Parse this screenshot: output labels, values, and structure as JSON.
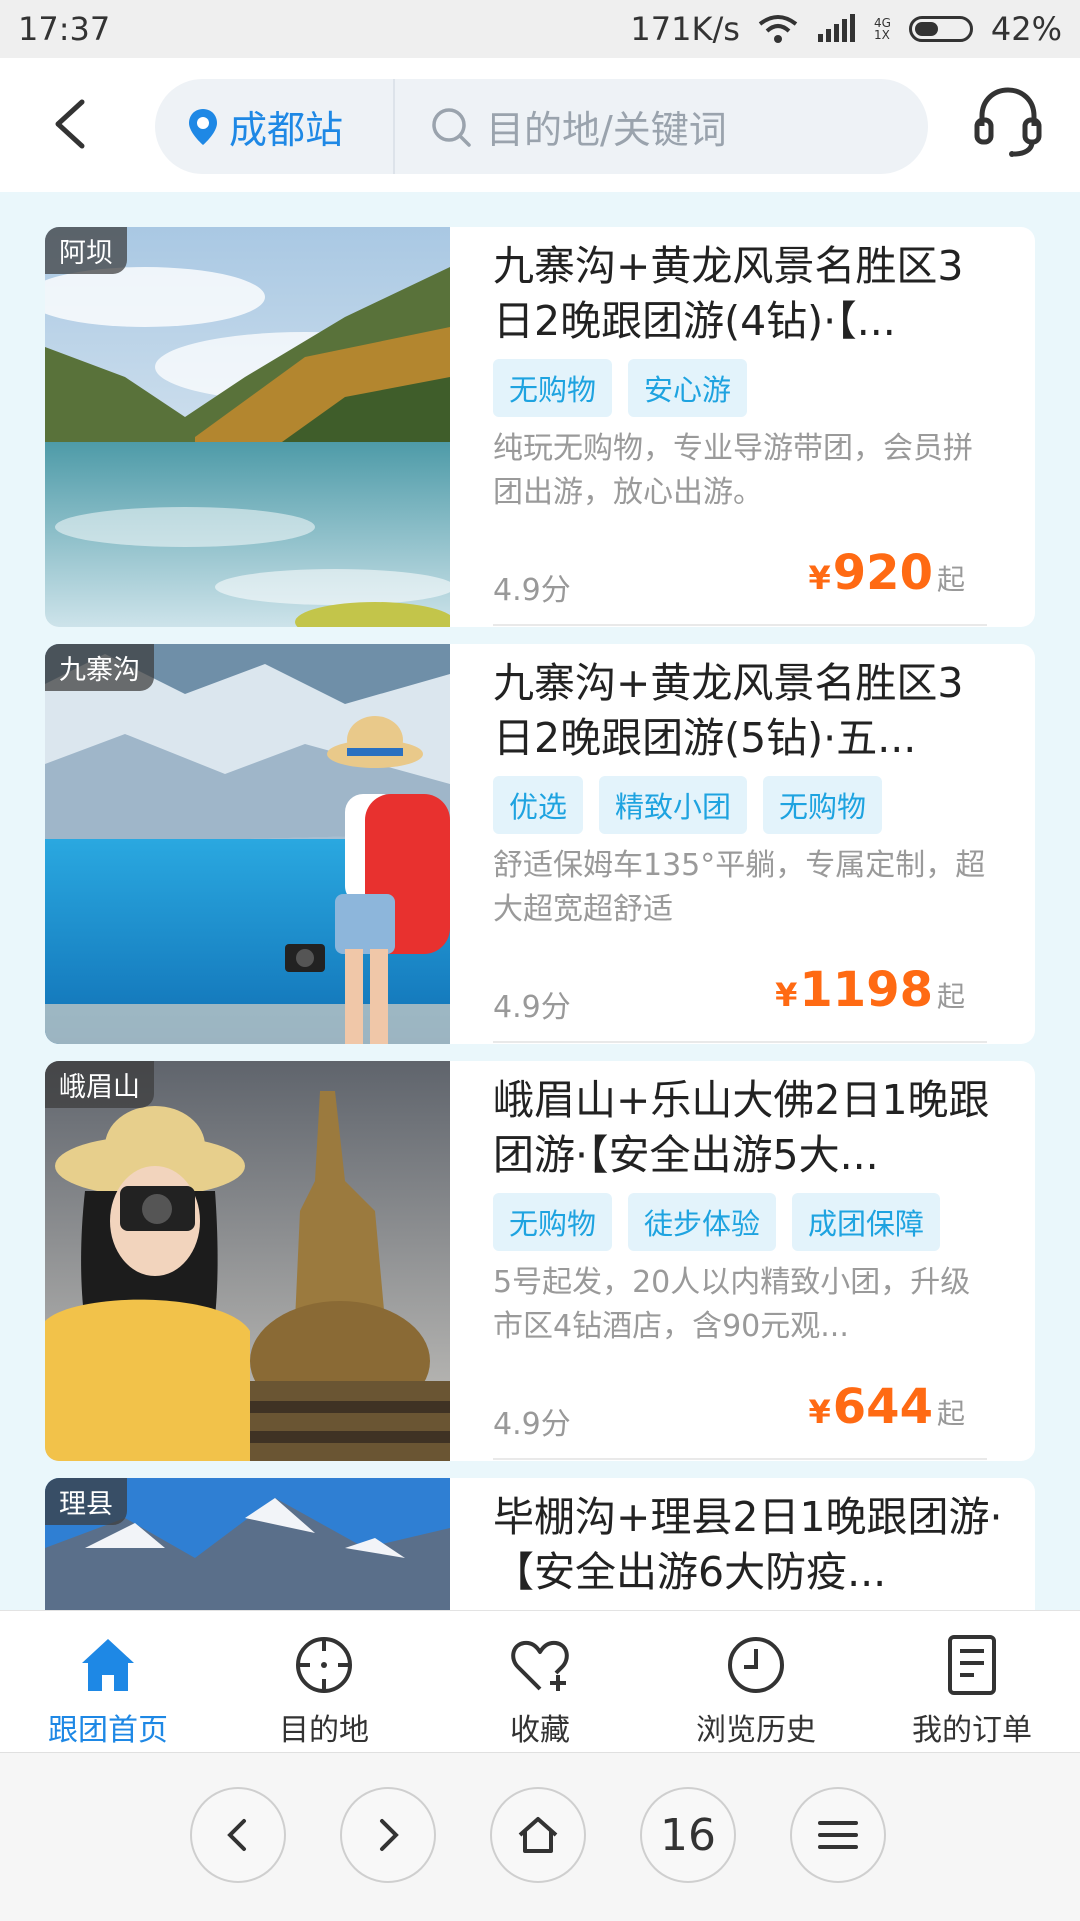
{
  "status_bar": {
    "time": "17:37",
    "speed": "171K/s",
    "network_top": "4G",
    "network_bottom": "1X",
    "battery": "42%"
  },
  "header": {
    "back_icon": "chevron-left-icon",
    "city": "成都站",
    "search_placeholder": "目的地/关键词",
    "service_icon": "headset-icon",
    "accent": "#1e88e5"
  },
  "products": [
    {
      "location": "阿坝",
      "title": "九寨沟+黄龙风景名胜区3日2晚跟团游(4钻)·【...",
      "tags": [
        "无购物",
        "安心游"
      ],
      "desc": "纯玩无购物，专业导游带团，会员拼团出游，放心出游。",
      "score": "4.9分",
      "currency": "¥",
      "price": "920",
      "price_suffix": "起"
    },
    {
      "location": "九寨沟",
      "title": "九寨沟+黄龙风景名胜区3日2晚跟团游(5钻)·五...",
      "tags": [
        "优选",
        "精致小团",
        "无购物"
      ],
      "desc": "舒适保姆车135°平躺，专属定制，超大超宽超舒适",
      "score": "4.9分",
      "currency": "¥",
      "price": "1198",
      "price_suffix": "起"
    },
    {
      "location": "峨眉山",
      "title": "峨眉山+乐山大佛2日1晚跟团游·【安全出游5大...",
      "tags": [
        "无购物",
        "徒步体验",
        "成团保障"
      ],
      "desc": "5号起发，20人以内精致小团，升级市区4钻酒店，含90元观...",
      "score": "4.9分",
      "currency": "¥",
      "price": "644",
      "price_suffix": "起"
    },
    {
      "location": "理县",
      "title": "毕棚沟+理县2日1晚跟团游·【安全出游6大防疫...",
      "tags": [],
      "desc": "",
      "score": "",
      "currency": "",
      "price": "",
      "price_suffix": ""
    }
  ],
  "bottom_nav": [
    {
      "label": "跟团首页",
      "icon": "home-icon",
      "active": true
    },
    {
      "label": "目的地",
      "icon": "crosshair-icon",
      "active": false
    },
    {
      "label": "收藏",
      "icon": "heart-plus-icon",
      "active": false
    },
    {
      "label": "浏览历史",
      "icon": "clock-icon",
      "active": false
    },
    {
      "label": "我的订单",
      "icon": "order-list-icon",
      "active": false
    }
  ],
  "browser_bar": {
    "tab_count": "16"
  },
  "colors": {
    "price": "#ff6a13",
    "chip_bg": "#e3f3fb",
    "chip_text": "#1ea3e0",
    "page_bg": "#eaf7fb"
  }
}
